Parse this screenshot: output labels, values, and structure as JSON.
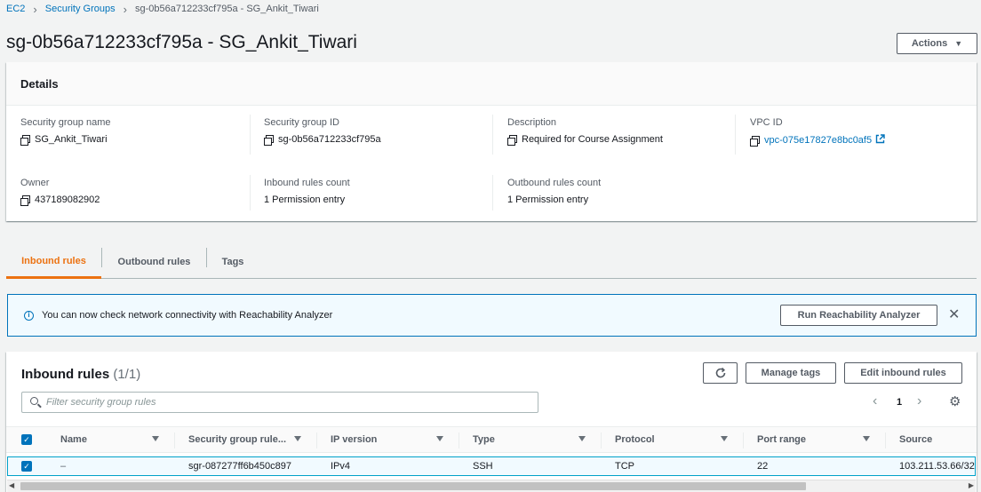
{
  "breadcrumb": {
    "root": "EC2",
    "parent": "Security Groups",
    "current": "sg-0b56a712233cf795a - SG_Ankit_Tiwari"
  },
  "page_title": "sg-0b56a712233cf795a - SG_Ankit_Tiwari",
  "actions_label": "Actions",
  "details": {
    "title": "Details",
    "fields": {
      "sg_name": {
        "label": "Security group name",
        "value": "SG_Ankit_Tiwari"
      },
      "sg_id": {
        "label": "Security group ID",
        "value": "sg-0b56a712233cf795a"
      },
      "description": {
        "label": "Description",
        "value": "Required for Course Assignment"
      },
      "vpc_id": {
        "label": "VPC ID",
        "value": "vpc-075e17827e8bc0af5"
      },
      "owner": {
        "label": "Owner",
        "value": "437189082902"
      },
      "inbound_count": {
        "label": "Inbound rules count",
        "value": "1 Permission entry"
      },
      "outbound_count": {
        "label": "Outbound rules count",
        "value": "1 Permission entry"
      }
    }
  },
  "tabs": [
    {
      "label": "Inbound rules",
      "active": true
    },
    {
      "label": "Outbound rules",
      "active": false
    },
    {
      "label": "Tags",
      "active": false
    }
  ],
  "banner": {
    "text": "You can now check network connectivity with Reachability Analyzer",
    "button": "Run Reachability Analyzer"
  },
  "rules": {
    "title": "Inbound rules",
    "count": "(1/1)",
    "manage_tags": "Manage tags",
    "edit_button": "Edit inbound rules",
    "search_placeholder": "Filter security group rules",
    "page": "1",
    "columns": [
      "Name",
      "Security group rule...",
      "IP version",
      "Type",
      "Protocol",
      "Port range",
      "Source"
    ],
    "row": {
      "name": "–",
      "rule_id": "sgr-087277ff6b450c897",
      "ip_version": "IPv4",
      "type": "SSH",
      "protocol": "TCP",
      "port_range": "22",
      "source": "103.211.53.66/32"
    }
  },
  "colors": {
    "accent": "#ec7211",
    "link": "#0073bb",
    "info_bg": "#f1faff"
  }
}
